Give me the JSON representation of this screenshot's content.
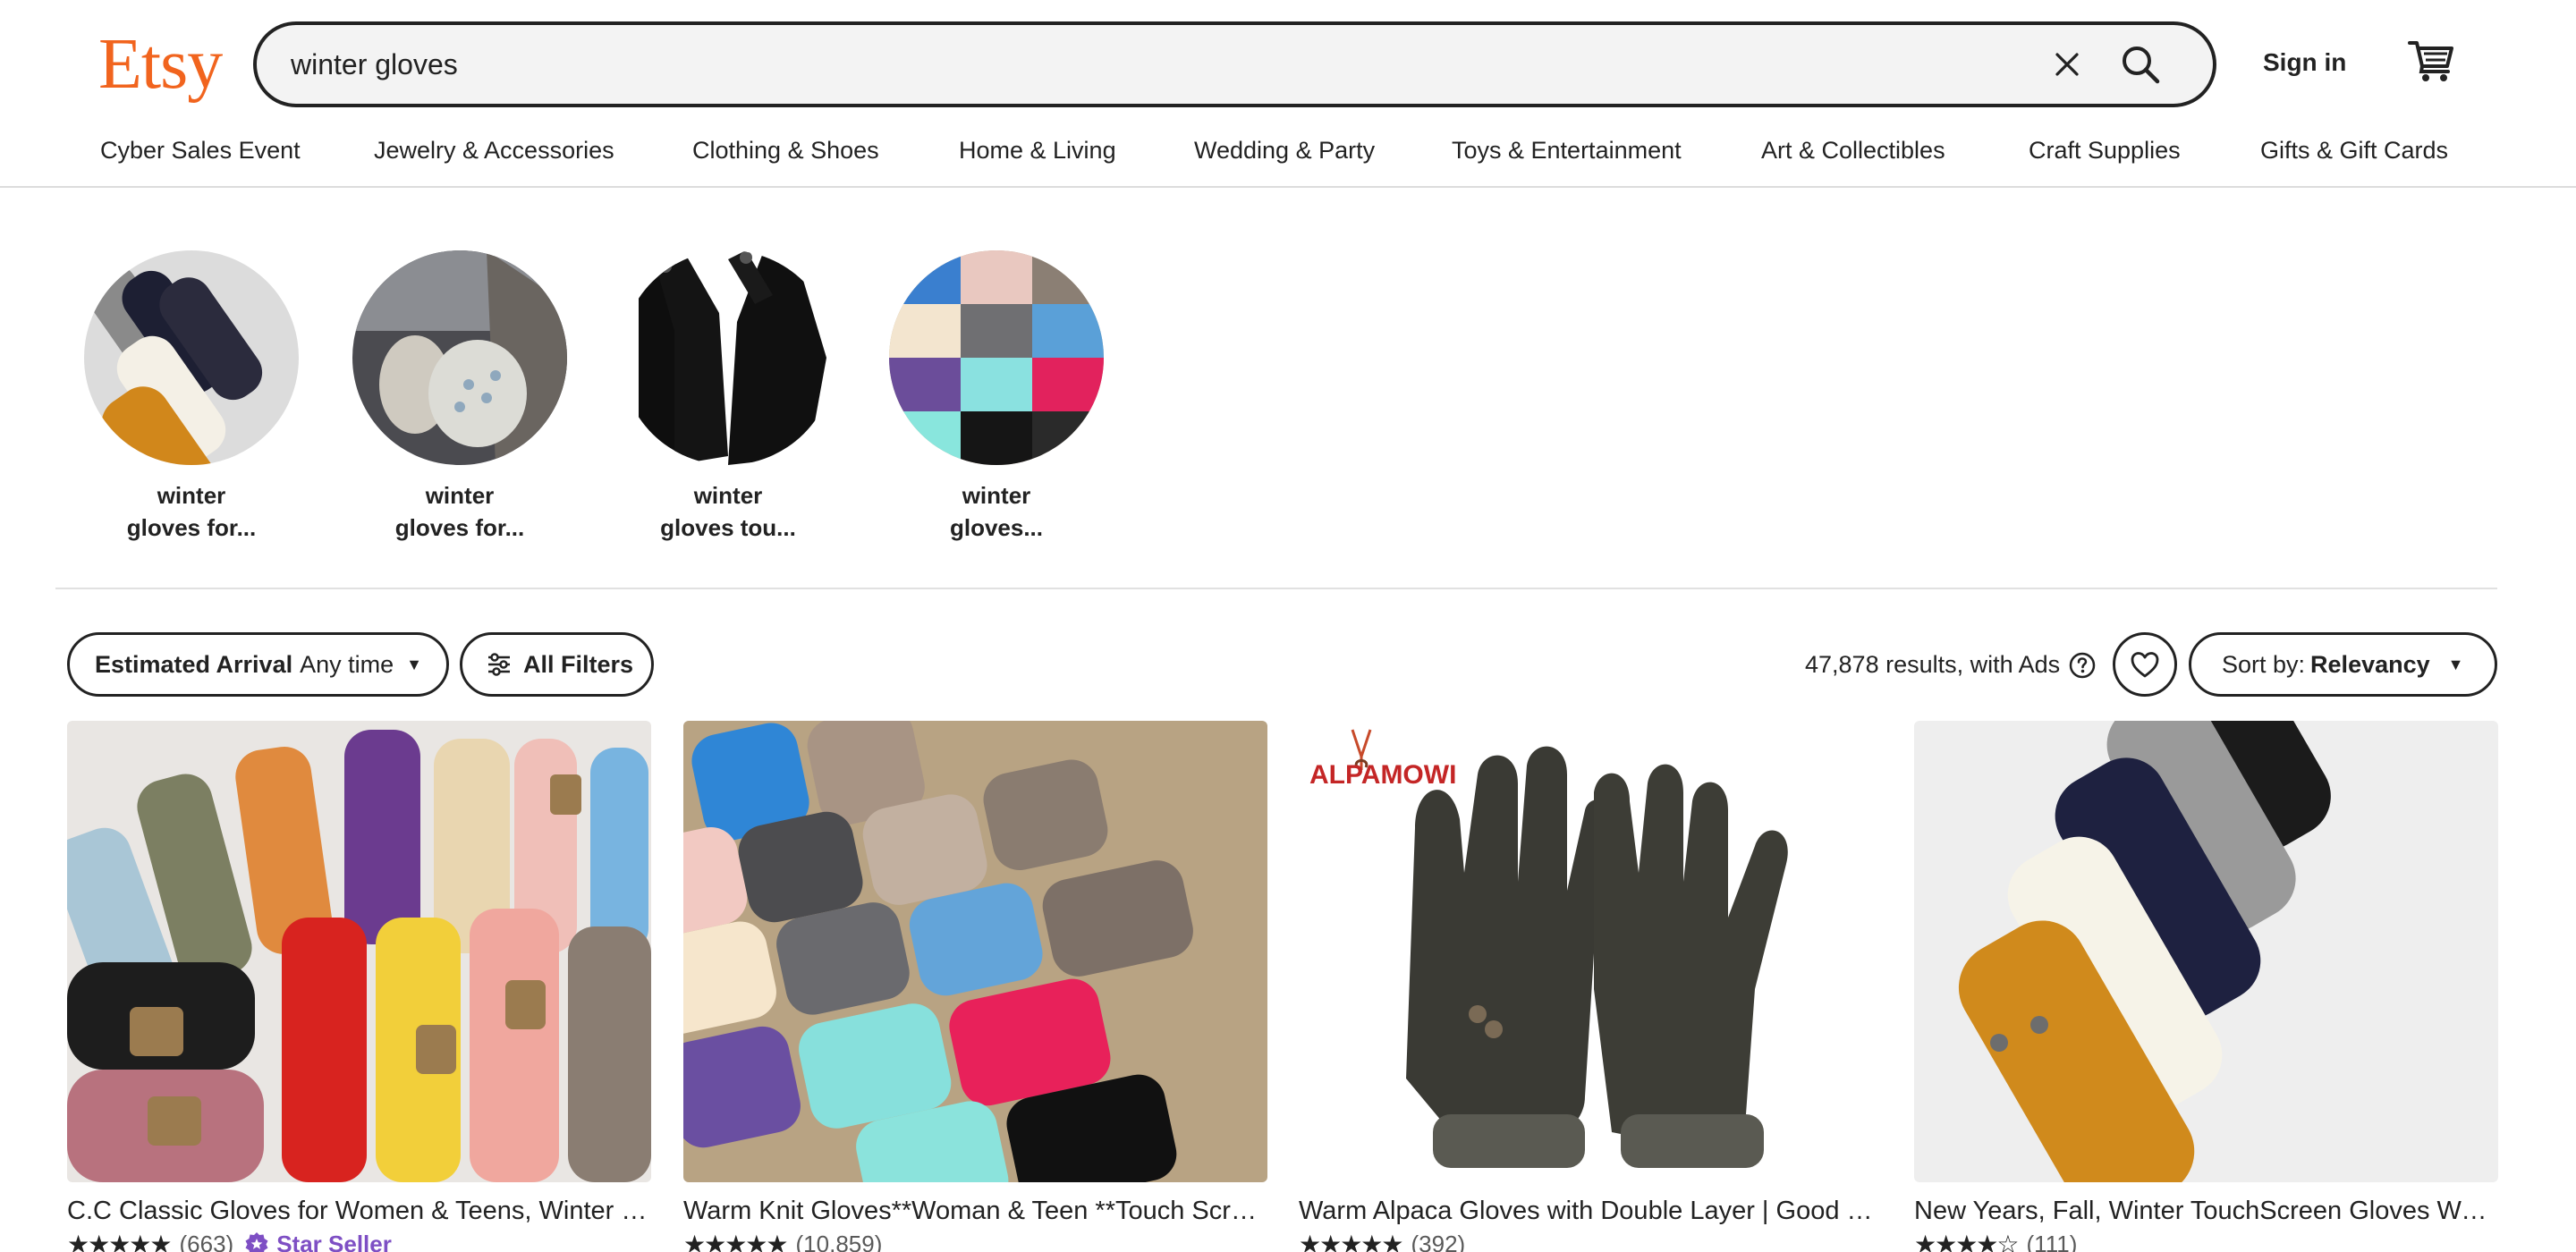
{
  "header": {
    "logo": "Etsy",
    "search_value": "winter gloves",
    "signin": "Sign in"
  },
  "nav": [
    "Cyber Sales Event",
    "Jewelry & Accessories",
    "Clothing & Shoes",
    "Home & Living",
    "Wedding & Party",
    "Toys & Entertainment",
    "Art & Collectibles",
    "Craft Supplies",
    "Gifts & Gift Cards"
  ],
  "categories": [
    {
      "line1": "winter",
      "line2": "gloves for..."
    },
    {
      "line1": "winter",
      "line2": "gloves for..."
    },
    {
      "line1": "winter",
      "line2": "gloves tou..."
    },
    {
      "line1": "winter",
      "line2": "gloves..."
    }
  ],
  "filters": {
    "estimated_label": "Estimated Arrival",
    "estimated_value": "Any time",
    "all_filters": "All Filters",
    "results": "47,878 results, with Ads",
    "sort_label": "Sort by:",
    "sort_value": "Relevancy"
  },
  "listings": [
    {
      "title": "C.C Classic Gloves for Women & Teens, Winter Knit Gloves, Touchscreen",
      "stars": "★★★★★",
      "rating": 5,
      "reviews": "(663)",
      "badge": "Star Seller"
    },
    {
      "title": "Warm Knit Gloves**Woman & Teen **Touch Screen Gloves",
      "stars": "★★★★★",
      "rating": 5,
      "reviews": "(10,859)",
      "badge": ""
    },
    {
      "title": "Warm Alpaca Gloves with Double Layer | Good Gift",
      "stars": "★★★★★",
      "rating": 5,
      "reviews": "(392)",
      "badge": "",
      "brand": "ALPAMOWI"
    },
    {
      "title": "New Years, Fall, Winter TouchScreen Gloves Women",
      "stars": "★★★★☆",
      "rating": 4.5,
      "reviews": "(111)",
      "badge": ""
    }
  ],
  "colors": {
    "brand": "#f1641e",
    "star_seller": "#7e4fc4"
  }
}
